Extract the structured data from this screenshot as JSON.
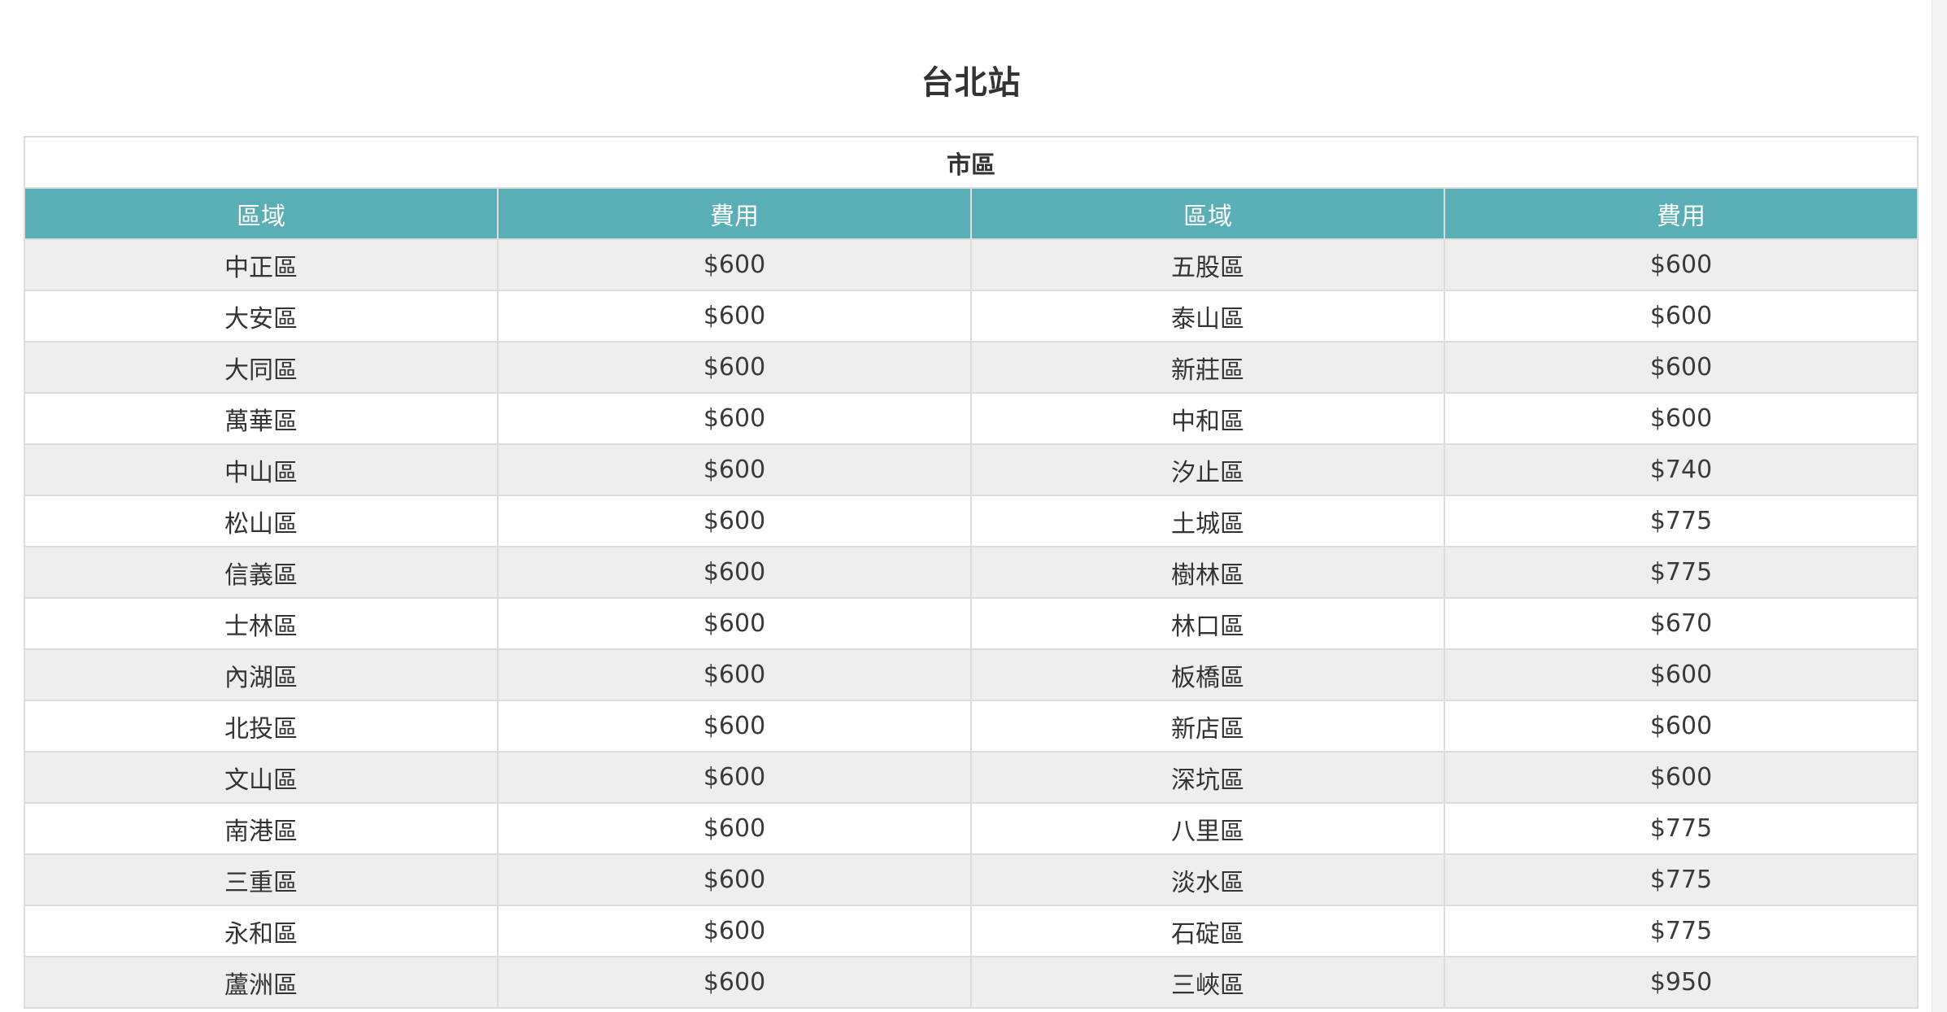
{
  "page": {
    "title": "台北站"
  },
  "table": {
    "section_header": "市區",
    "columns": [
      "區域",
      "費用",
      "區域",
      "費用"
    ],
    "rows": [
      {
        "area_left": "中正區",
        "fee_left": "$600",
        "area_right": "五股區",
        "fee_right": "$600"
      },
      {
        "area_left": "大安區",
        "fee_left": "$600",
        "area_right": "泰山區",
        "fee_right": "$600"
      },
      {
        "area_left": "大同區",
        "fee_left": "$600",
        "area_right": "新莊區",
        "fee_right": "$600"
      },
      {
        "area_left": "萬華區",
        "fee_left": "$600",
        "area_right": "中和區",
        "fee_right": "$600"
      },
      {
        "area_left": "中山區",
        "fee_left": "$600",
        "area_right": "汐止區",
        "fee_right": "$740"
      },
      {
        "area_left": "松山區",
        "fee_left": "$600",
        "area_right": "土城區",
        "fee_right": "$775"
      },
      {
        "area_left": "信義區",
        "fee_left": "$600",
        "area_right": "樹林區",
        "fee_right": "$775"
      },
      {
        "area_left": "士林區",
        "fee_left": "$600",
        "area_right": "林口區",
        "fee_right": "$670"
      },
      {
        "area_left": "內湖區",
        "fee_left": "$600",
        "area_right": "板橋區",
        "fee_right": "$600"
      },
      {
        "area_left": "北投區",
        "fee_left": "$600",
        "area_right": "新店區",
        "fee_right": "$600"
      },
      {
        "area_left": "文山區",
        "fee_left": "$600",
        "area_right": "深坑區",
        "fee_right": "$600"
      },
      {
        "area_left": "南港區",
        "fee_left": "$600",
        "area_right": "八里區",
        "fee_right": "$775"
      },
      {
        "area_left": "三重區",
        "fee_left": "$600",
        "area_right": "淡水區",
        "fee_right": "$775"
      },
      {
        "area_left": "永和區",
        "fee_left": "$600",
        "area_right": "石碇區",
        "fee_right": "$775"
      },
      {
        "area_left": "蘆洲區",
        "fee_left": "$600",
        "area_right": "三峽區",
        "fee_right": "$950"
      }
    ]
  },
  "colors": {
    "header_teal": "#5aaeb5",
    "row_stripe": "#eeeeee",
    "text": "#333333"
  }
}
